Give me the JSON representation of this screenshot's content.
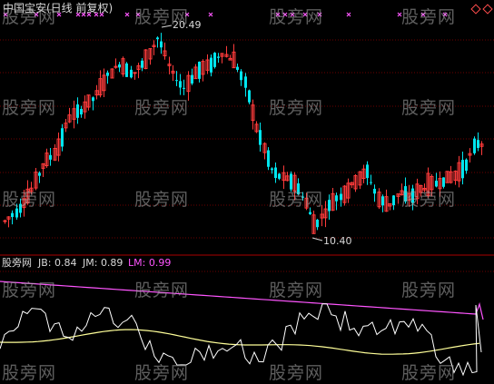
{
  "window": {
    "title": "中国宝安(日线 前复权)"
  },
  "price_panel": {
    "high_label": "20.49",
    "low_label": "10.40",
    "high_value": 20.49,
    "low_value": 10.4
  },
  "indicator_panel": {
    "name": "股旁网",
    "jb_text": "JB: 0.84",
    "jm_text": "JM: 0.89",
    "lm_text": "LM: 0.99",
    "jb": 0.84,
    "jm": 0.89,
    "lm": 0.99
  },
  "watermark": "股旁网",
  "colors": {
    "background": "#000000",
    "up_candle": "#ff3b3b",
    "down_candle": "#00e5ee",
    "grid": "#6b0000",
    "lm_line": "#ff55ff",
    "jm_line": "#ffff99",
    "jb_line": "#ffffff",
    "signal_marker": "#ff55ff"
  },
  "icons": [
    "diamond-marker-icon",
    "x-signal-marker-icon"
  ]
}
